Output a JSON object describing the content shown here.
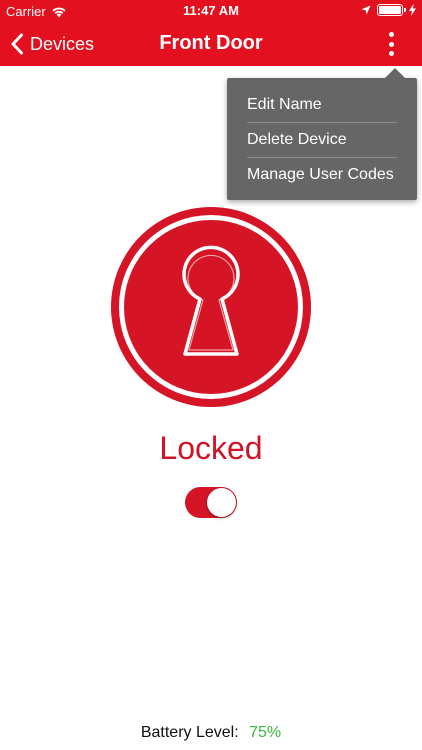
{
  "status_bar": {
    "carrier": "Carrier",
    "time": "11:47 AM",
    "icons": [
      "wifi-icon",
      "location-arrow-icon",
      "battery-icon",
      "charging-bolt-icon"
    ]
  },
  "nav": {
    "back_label": "Devices",
    "title": "Front Door",
    "back_icon": "chevron-left-icon",
    "more_icon": "more-vertical-icon"
  },
  "menu": {
    "items": [
      {
        "label": "Edit Name"
      },
      {
        "label": "Delete Device"
      },
      {
        "label": "Manage User Codes"
      }
    ]
  },
  "lock": {
    "icon": "keyhole-icon",
    "status": "Locked",
    "toggle_on": true
  },
  "battery": {
    "label": "Battery Level:",
    "value": "75%"
  },
  "colors": {
    "brand_red": "#e3101f",
    "lock_red": "#d51426",
    "menu_bg": "#666666",
    "battery_green": "#3cb73c"
  }
}
